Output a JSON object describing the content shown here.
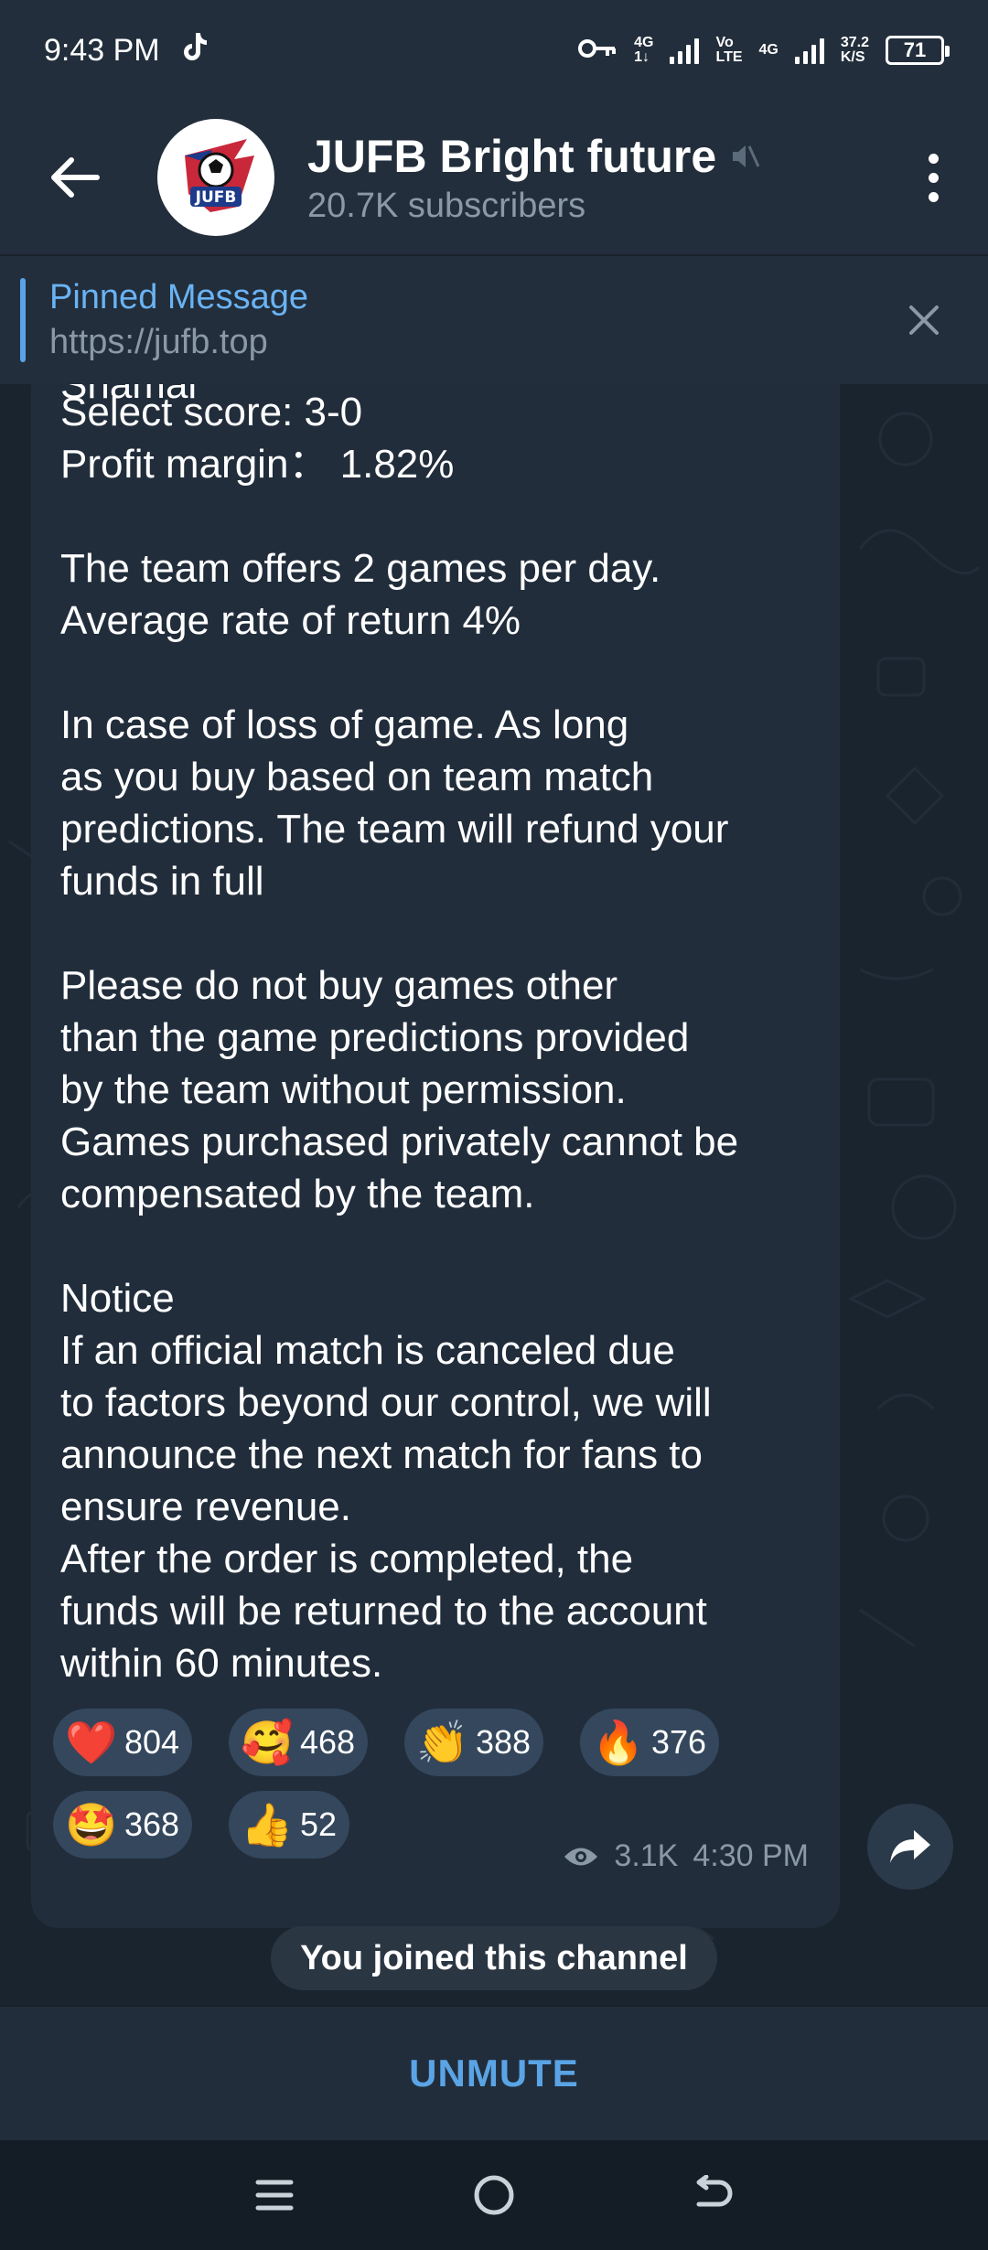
{
  "status_bar": {
    "time": "9:43 PM",
    "net1_top": "4G",
    "net1_bottom": "1↓",
    "volte_top": "Vo",
    "volte_bottom": "LTE",
    "net2": "4G",
    "speed_value": "37.2",
    "speed_unit": "K/S",
    "battery": "71"
  },
  "header": {
    "title": "JUFB Bright future",
    "subscribers": "20.7K subscribers",
    "avatar_text": "JUFB"
  },
  "pinned": {
    "title": "Pinned Message",
    "link": "https://jufb.top"
  },
  "message": {
    "cut_line": "Shamal",
    "text": "Select score: 3-0\nProfit margin：  1.82%\n\nThe team offers 2 games per day.\nAverage rate of return 4%\n\nIn case of loss of game. As long\nas you buy based on team match\npredictions. The team will refund your\nfunds in full\n\nPlease do not buy games other\nthan the game predictions provided\nby the team without permission.\nGames purchased privately cannot be\ncompensated by the team.\n\nNotice\nIf an official match is canceled due\nto factors beyond our control, we will\nannounce the next match for fans to\nensure revenue.\nAfter the order is completed, the\nfunds will be returned to the account\nwithin 60 minutes.",
    "views": "3.1K",
    "time": "4:30 PM",
    "reactions": [
      {
        "emoji": "❤️",
        "icon": "heart-icon",
        "count": "804"
      },
      {
        "emoji": "🥰",
        "icon": "smiling-face-with-hearts-icon",
        "count": "468"
      },
      {
        "emoji": "👏",
        "icon": "clapping-hands-icon",
        "count": "388"
      },
      {
        "emoji": "🔥",
        "icon": "fire-icon",
        "count": "376"
      },
      {
        "emoji": "🤩",
        "icon": "star-struck-icon",
        "count": "368"
      },
      {
        "emoji": "👍",
        "icon": "thumbs-up-icon",
        "count": "52"
      }
    ]
  },
  "service_message": "You joined this channel",
  "bottom": {
    "unmute_label": "UNMUTE"
  },
  "colors": {
    "accent": "#5aa4e6",
    "bubble": "#212d3b",
    "reaction_pill": "#34475d",
    "muted_text": "#8b98a6"
  }
}
